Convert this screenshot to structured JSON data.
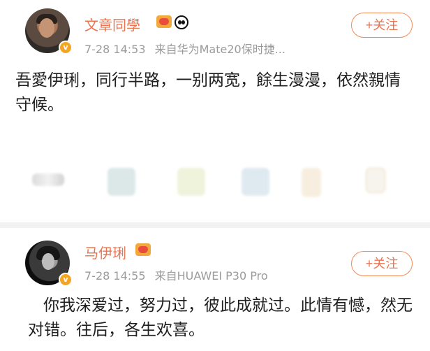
{
  "post_1": {
    "username": "文章同學",
    "timestamp": "7-28 14:53",
    "source": "来自华为Mate20保时捷...",
    "follow_label": "+关注",
    "content": "吾愛伊琍，同行半路，一别两宽，餘生漫漫，依然親情守候。"
  },
  "post_2": {
    "username": "马伊琍",
    "timestamp": "7-28 14:55",
    "source": "来自HUAWEI P30 Pro",
    "follow_label": "+关注",
    "content": "你我深爱过，努力过，彼此成就过。此情有憾，然无对错。往后，各生欢喜。"
  },
  "icons": {
    "verified_badge": "verified-badge-icon",
    "vip_badge": "vip-badge-icon",
    "panda_badge": "panda-icon",
    "toolbar_icons": [
      "repost-icon",
      "comment-icon",
      "like-icon",
      "share-icon",
      "forward-icon",
      "more-icon"
    ]
  },
  "colors": {
    "username": "#eb7350",
    "follow_border": "#f08c5a",
    "meta_gray": "#9b9b9b",
    "separator": "#f2f2f2"
  }
}
